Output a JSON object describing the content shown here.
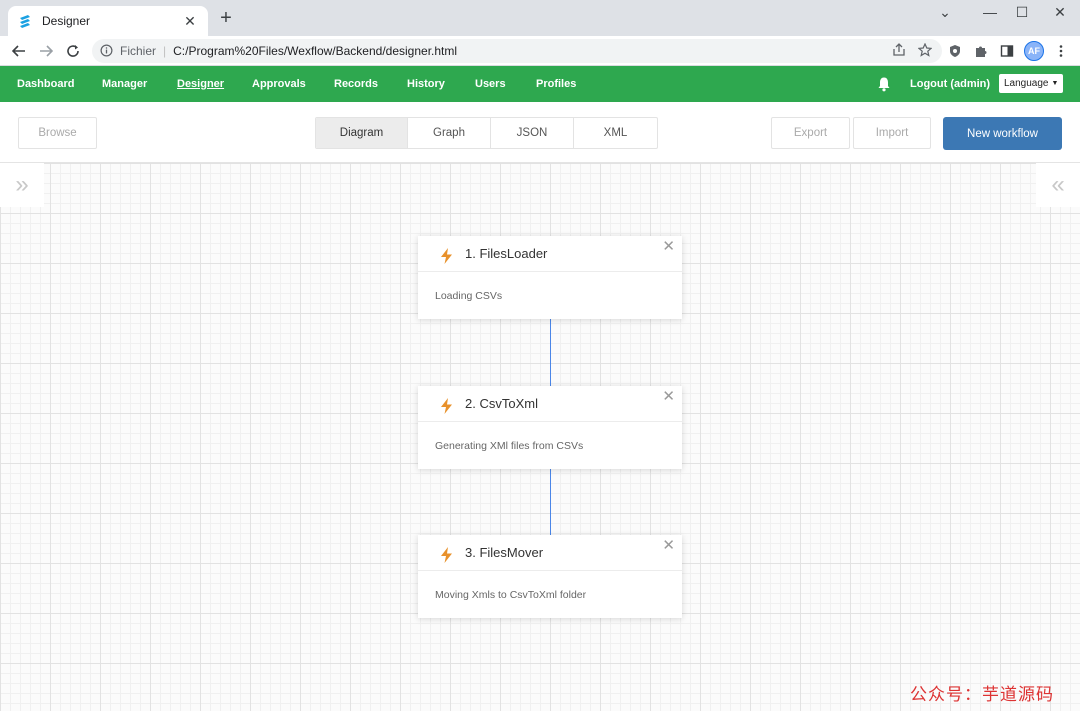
{
  "browser": {
    "tab_title": "Designer",
    "tab_close": "✕",
    "new_tab": "+",
    "url_scheme": "Fichier",
    "url": "C:/Program%20Files/Wexflow/Backend/designer.html",
    "avatar": "AF",
    "window_controls": {
      "minimize": "—",
      "maximize": "☐",
      "close": "✕",
      "dropdown": "⌄"
    }
  },
  "appnav": {
    "items": [
      {
        "label": "Dashboard"
      },
      {
        "label": "Manager"
      },
      {
        "label": "Designer"
      },
      {
        "label": "Approvals"
      },
      {
        "label": "Records"
      },
      {
        "label": "History"
      },
      {
        "label": "Users"
      },
      {
        "label": "Profiles"
      }
    ],
    "active": "Designer",
    "logout": "Logout (admin)",
    "language": "Language"
  },
  "toolbar": {
    "browse": "Browse",
    "tabs": [
      {
        "label": "Diagram"
      },
      {
        "label": "Graph"
      },
      {
        "label": "JSON"
      },
      {
        "label": "XML"
      }
    ],
    "active_tab": "Diagram",
    "export": "Export",
    "import": "Import",
    "new_workflow": "New workflow"
  },
  "canvas": {
    "toggle_left": "»",
    "toggle_right": "«",
    "tasks": [
      {
        "title": "1. FilesLoader",
        "description": "Loading CSVs"
      },
      {
        "title": "2. CsvToXml",
        "description": "Generating XMl files from CSVs"
      },
      {
        "title": "3. FilesMover",
        "description": "Moving Xmls to CsvToXml folder"
      }
    ],
    "close_glyph": "✕"
  },
  "watermark": "公众号：芋道源码",
  "colors": {
    "nav_green": "#2ea84f",
    "primary_blue": "#3c78b4",
    "bolt_orange": "#e8912b",
    "connector_blue": "#4a86e8"
  },
  "icons": {
    "tab": "wexflow-logo-icon",
    "task": "bolt-icon",
    "notifications": "bell-icon"
  }
}
